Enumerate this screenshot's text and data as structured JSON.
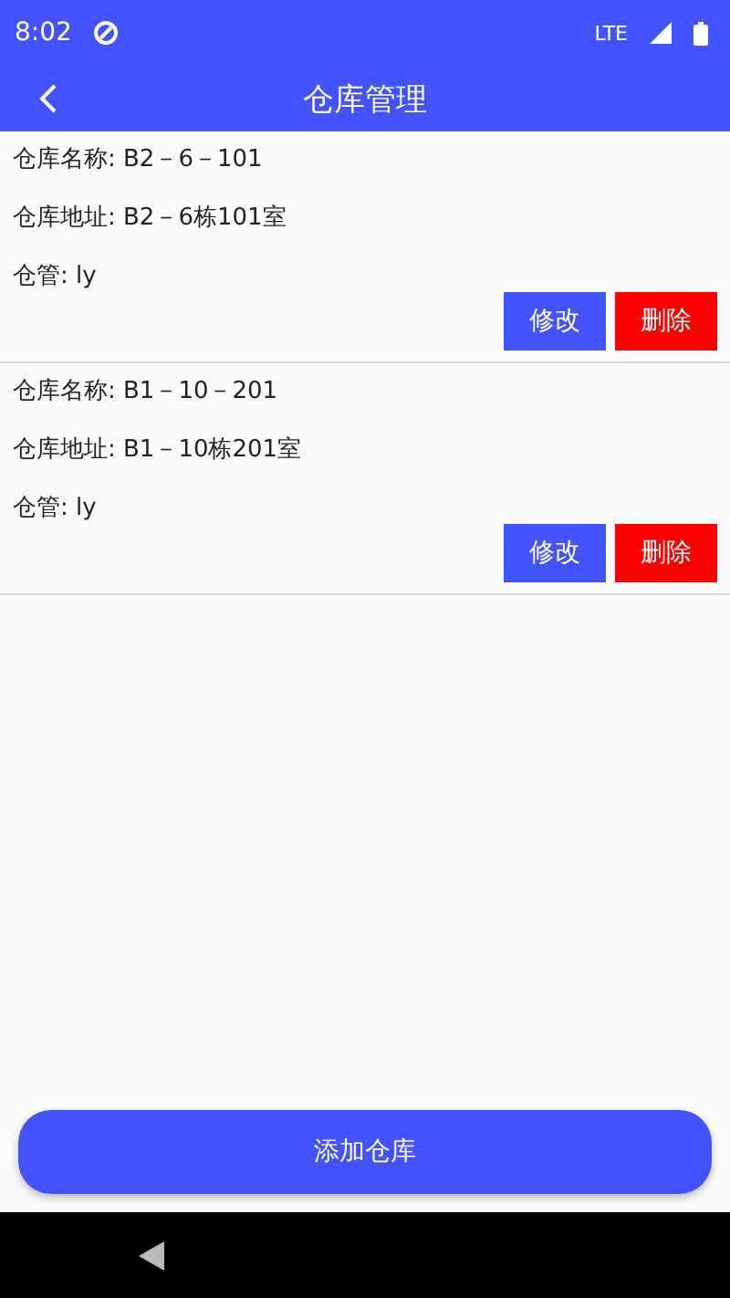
{
  "status_bar": {
    "time": "8:02",
    "network": "LTE"
  },
  "app_bar": {
    "title": "仓库管理"
  },
  "warehouses": [
    {
      "name": "仓库名称: B2－6－101",
      "address": "仓库地址: B2－6栋101室",
      "keeper": "仓管: ly",
      "edit": "修改",
      "delete": "删除"
    },
    {
      "name": "仓库名称: B1－10－201",
      "address": "仓库地址: B1－10栋201室",
      "keeper": "仓管: ly",
      "edit": "修改",
      "delete": "删除"
    }
  ],
  "add_button": "添加仓库"
}
